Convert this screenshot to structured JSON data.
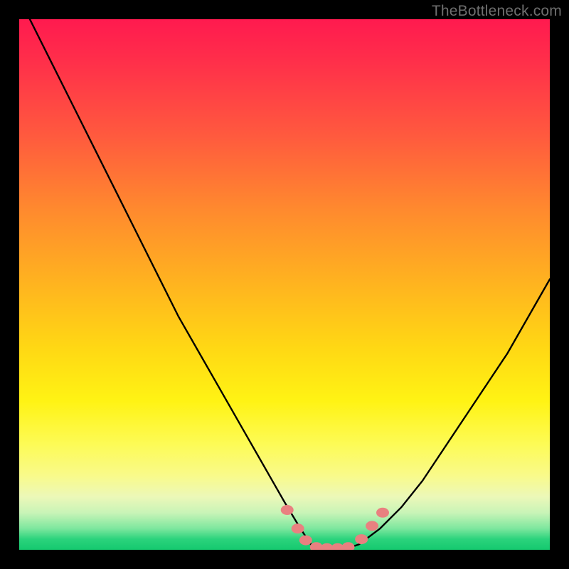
{
  "watermark": "TheBottleneck.com",
  "chart_data": {
    "type": "line",
    "title": "",
    "xlabel": "",
    "ylabel": "",
    "xlim": [
      0,
      100
    ],
    "ylim": [
      0,
      100
    ],
    "grid": false,
    "legend": false,
    "background_gradient_meaning": "bottleneck severity (red=high, green=none)",
    "series": [
      {
        "name": "bottleneck-curve",
        "color": "#000000",
        "x": [
          2,
          6,
          10,
          14,
          18,
          22,
          26,
          30,
          34,
          38,
          42,
          46,
          50,
          53,
          55,
          58,
          61,
          64,
          68,
          72,
          76,
          80,
          84,
          88,
          92,
          96,
          100
        ],
        "y": [
          100,
          92,
          84,
          76,
          68,
          60,
          52,
          44,
          37,
          30,
          23,
          16,
          9,
          4,
          1,
          0,
          0,
          1,
          4,
          8,
          13,
          19,
          25,
          31,
          37,
          44,
          51
        ]
      }
    ],
    "markers": [
      {
        "name": "left-marker-upper",
        "x": 50.5,
        "y": 7.5
      },
      {
        "name": "left-marker-mid",
        "x": 52.5,
        "y": 4.0
      },
      {
        "name": "left-marker-low",
        "x": 54.0,
        "y": 1.8
      },
      {
        "name": "bottom-1",
        "x": 56.0,
        "y": 0.5
      },
      {
        "name": "bottom-2",
        "x": 58.0,
        "y": 0.3
      },
      {
        "name": "bottom-3",
        "x": 60.0,
        "y": 0.3
      },
      {
        "name": "bottom-4",
        "x": 62.0,
        "y": 0.5
      },
      {
        "name": "right-marker-low",
        "x": 64.5,
        "y": 2.0
      },
      {
        "name": "right-marker-mid",
        "x": 66.5,
        "y": 4.5
      },
      {
        "name": "right-marker-upper",
        "x": 68.5,
        "y": 7.0
      }
    ],
    "marker_color": "#e98080"
  }
}
